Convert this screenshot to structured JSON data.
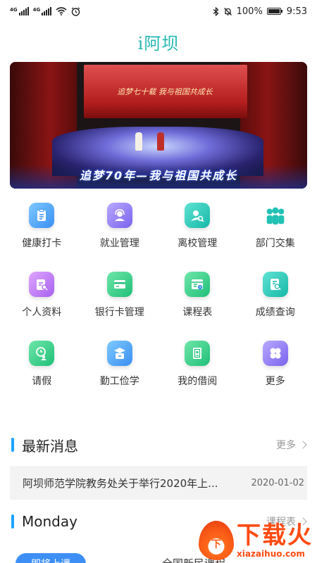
{
  "status_bar": {
    "signal_1": "4G",
    "signal_2": "4G",
    "battery": "100%",
    "time": "9:53"
  },
  "app": {
    "title": "i阿坝"
  },
  "banner": {
    "screen_text": "追梦七十载 我与祖国共成长",
    "slogan": "追梦70年—我与祖国共成长"
  },
  "menu": [
    {
      "label": "健康打卡",
      "icon": "clipboard-icon",
      "color": "blue"
    },
    {
      "label": "就业管理",
      "icon": "headset-user-icon",
      "color": "violet"
    },
    {
      "label": "离校管理",
      "icon": "user-search-icon",
      "color": "teal"
    },
    {
      "label": "部门交集",
      "icon": "group-icon",
      "color": "plain"
    },
    {
      "label": "个人资料",
      "icon": "profile-doc-icon",
      "color": "purple"
    },
    {
      "label": "银行卡管理",
      "icon": "bank-card-icon",
      "color": "green"
    },
    {
      "label": "课程表",
      "icon": "schedule-icon",
      "color": "green"
    },
    {
      "label": "成绩查询",
      "icon": "grade-search-icon",
      "color": "teal"
    },
    {
      "label": "请假",
      "icon": "leave-clock-icon",
      "color": "green"
    },
    {
      "label": "勤工俭学",
      "icon": "work-study-icon",
      "color": "blue"
    },
    {
      "label": "我的借阅",
      "icon": "book-icon",
      "color": "green"
    },
    {
      "label": "更多",
      "icon": "more-grid-icon",
      "color": "violet"
    }
  ],
  "news": {
    "title": "最新消息",
    "more": "更多",
    "items": [
      {
        "title": "阿坝师范学院教务处关于举行2020年上...",
        "date": "2020-01-02"
      }
    ]
  },
  "schedule": {
    "title": "Monday",
    "more": "课程表",
    "button": "即将上课",
    "course": "全国新民课程"
  },
  "watermark": {
    "big": "下载火",
    "small": "xiazaihuo.com",
    "badge": "下"
  },
  "colors": {
    "accent": "#1fa2ff",
    "title_teal": "#23b7b0",
    "button_blue": "#3d8ff5"
  }
}
